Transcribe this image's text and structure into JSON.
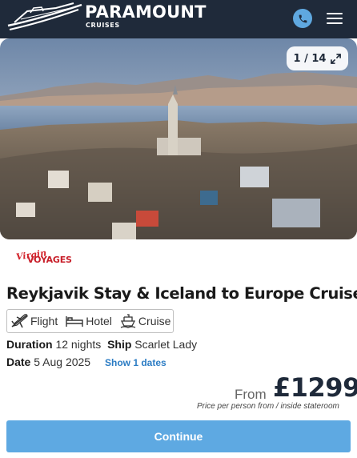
{
  "header": {
    "brand_name": "PARAMOUNT",
    "brand_sub": "CRUISES",
    "phone_icon": "phone-icon",
    "menu_icon": "hamburger-menu-icon"
  },
  "gallery": {
    "position": "1 / 14",
    "expand_icon": "expand-icon",
    "image_alt": "Reykjavik city skyline with church and mountains"
  },
  "operator": {
    "logo_top": "Virgin",
    "logo_bottom": "VOYAGES"
  },
  "holiday": {
    "title": "Reykjavik Stay & Iceland to Europe Cruise",
    "features": [
      {
        "label": "Flight",
        "icon": "plane-icon"
      },
      {
        "label": "Hotel",
        "icon": "bed-icon"
      },
      {
        "label": "Cruise",
        "icon": "ship-icon"
      }
    ],
    "duration_label": "Duration",
    "duration_value": "12 nights",
    "ship_label": "Ship",
    "ship_value": "Scarlet Lady",
    "date_label": "Date",
    "date_value": "5 Aug 2025",
    "show_dates": "Show 1 dates"
  },
  "price": {
    "from": "From",
    "amount": "£1299",
    "note": "Price per person from / inside stateroom"
  },
  "actions": {
    "continue": "Continue"
  },
  "colors": {
    "header_bg": "#1f2a3a",
    "accent_blue": "#5ea9e2",
    "brand_red": "#d3242c"
  }
}
